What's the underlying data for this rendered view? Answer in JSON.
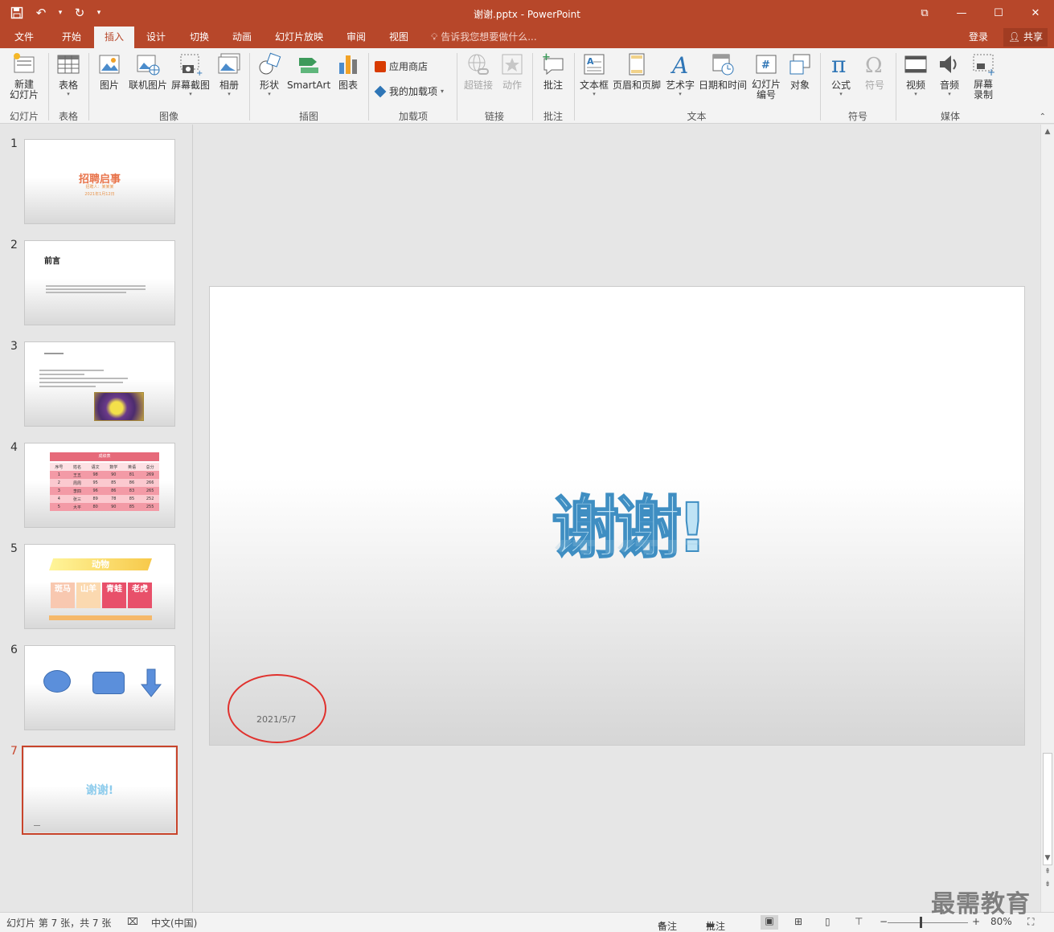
{
  "window": {
    "title": "谢谢.pptx - PowerPoint"
  },
  "tabs": [
    "文件",
    "开始",
    "插入",
    "设计",
    "切换",
    "动画",
    "幻灯片放映",
    "审阅",
    "视图"
  ],
  "active_tab": "插入",
  "tell_me": "告诉我您想要做什么...",
  "account": {
    "signin": "登录",
    "share": "共享"
  },
  "ribbon": {
    "buttons": {
      "new_slide": "新建\n幻灯片",
      "table": "表格",
      "picture": "图片",
      "online_picture": "联机图片",
      "screenshot": "屏幕截图",
      "album": "相册",
      "shapes": "形状",
      "smartart": "SmartArt",
      "chart": "图表",
      "store": "应用商店",
      "my_addins": "我的加载项",
      "hyperlink": "超链接",
      "action": "动作",
      "comment": "批注",
      "textbox": "文本框",
      "header_footer": "页眉和页脚",
      "wordart": "艺术字",
      "datetime": "日期和时间",
      "slide_number": "幻灯片\n编号",
      "object": "对象",
      "equation": "公式",
      "symbol": "符号",
      "video": "视频",
      "audio": "音频",
      "screen_record": "屏幕\n录制"
    },
    "groups": {
      "slides": "幻灯片",
      "tables": "表格",
      "images": "图像",
      "illustrations": "插图",
      "addins": "加载项",
      "links": "链接",
      "comments": "批注",
      "text": "文本",
      "symbols": "符号",
      "media": "媒体"
    }
  },
  "thumbnails": {
    "s1": {
      "num": "1",
      "title": "招聘启事",
      "sub": "招聘人：某某某",
      "date": "2021年1月12日"
    },
    "s2": {
      "num": "2",
      "title": "前言"
    },
    "s3": {
      "num": "3"
    },
    "s4": {
      "num": "4",
      "title": "成绩表",
      "headers": [
        "序号",
        "姓名",
        "语文",
        "数学",
        "英语",
        "总分"
      ],
      "rows": [
        [
          "1",
          "王五",
          "98",
          "90",
          "81",
          "269"
        ],
        [
          "2",
          "周周",
          "95",
          "85",
          "86",
          "266"
        ],
        [
          "3",
          "李四",
          "96",
          "86",
          "83",
          "265"
        ],
        [
          "4",
          "张三",
          "89",
          "78",
          "85",
          "252"
        ],
        [
          "5",
          "大平",
          "80",
          "90",
          "85",
          "255"
        ]
      ]
    },
    "s5": {
      "num": "5",
      "title": "动物",
      "cells": [
        "斑马",
        "山羊",
        "青蛙",
        "老虎"
      ]
    },
    "s6": {
      "num": "6"
    },
    "s7": {
      "num": "7",
      "title": "谢谢!"
    }
  },
  "slide": {
    "title": "谢谢!",
    "date": "2021/5/7"
  },
  "status": {
    "slide_info": "幻灯片 第 7 张，共 7 张",
    "language": "中文(中国)",
    "notes": "备注",
    "comments": "批注",
    "zoom": "80%"
  },
  "watermark": "最需教育",
  "colors": {
    "accent": "#b7472a",
    "selection": "#c8442b",
    "annotation_circle": "#e0312d"
  }
}
